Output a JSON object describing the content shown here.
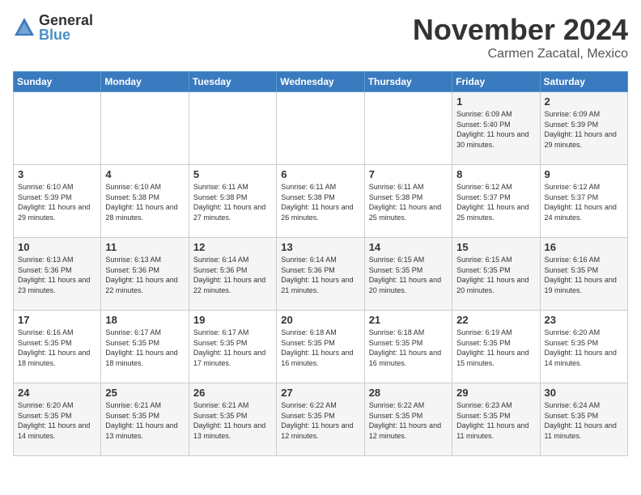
{
  "logo": {
    "text_general": "General",
    "text_blue": "Blue"
  },
  "title": "November 2024",
  "subtitle": "Carmen Zacatal, Mexico",
  "days_of_week": [
    "Sunday",
    "Monday",
    "Tuesday",
    "Wednesday",
    "Thursday",
    "Friday",
    "Saturday"
  ],
  "weeks": [
    [
      {
        "day": "",
        "info": ""
      },
      {
        "day": "",
        "info": ""
      },
      {
        "day": "",
        "info": ""
      },
      {
        "day": "",
        "info": ""
      },
      {
        "day": "",
        "info": ""
      },
      {
        "day": "1",
        "info": "Sunrise: 6:09 AM\nSunset: 5:40 PM\nDaylight: 11 hours and 30 minutes."
      },
      {
        "day": "2",
        "info": "Sunrise: 6:09 AM\nSunset: 5:39 PM\nDaylight: 11 hours and 29 minutes."
      }
    ],
    [
      {
        "day": "3",
        "info": "Sunrise: 6:10 AM\nSunset: 5:39 PM\nDaylight: 11 hours and 29 minutes."
      },
      {
        "day": "4",
        "info": "Sunrise: 6:10 AM\nSunset: 5:38 PM\nDaylight: 11 hours and 28 minutes."
      },
      {
        "day": "5",
        "info": "Sunrise: 6:11 AM\nSunset: 5:38 PM\nDaylight: 11 hours and 27 minutes."
      },
      {
        "day": "6",
        "info": "Sunrise: 6:11 AM\nSunset: 5:38 PM\nDaylight: 11 hours and 26 minutes."
      },
      {
        "day": "7",
        "info": "Sunrise: 6:11 AM\nSunset: 5:38 PM\nDaylight: 11 hours and 25 minutes."
      },
      {
        "day": "8",
        "info": "Sunrise: 6:12 AM\nSunset: 5:37 PM\nDaylight: 11 hours and 25 minutes."
      },
      {
        "day": "9",
        "info": "Sunrise: 6:12 AM\nSunset: 5:37 PM\nDaylight: 11 hours and 24 minutes."
      }
    ],
    [
      {
        "day": "10",
        "info": "Sunrise: 6:13 AM\nSunset: 5:36 PM\nDaylight: 11 hours and 23 minutes."
      },
      {
        "day": "11",
        "info": "Sunrise: 6:13 AM\nSunset: 5:36 PM\nDaylight: 11 hours and 22 minutes."
      },
      {
        "day": "12",
        "info": "Sunrise: 6:14 AM\nSunset: 5:36 PM\nDaylight: 11 hours and 22 minutes."
      },
      {
        "day": "13",
        "info": "Sunrise: 6:14 AM\nSunset: 5:36 PM\nDaylight: 11 hours and 21 minutes."
      },
      {
        "day": "14",
        "info": "Sunrise: 6:15 AM\nSunset: 5:35 PM\nDaylight: 11 hours and 20 minutes."
      },
      {
        "day": "15",
        "info": "Sunrise: 6:15 AM\nSunset: 5:35 PM\nDaylight: 11 hours and 20 minutes."
      },
      {
        "day": "16",
        "info": "Sunrise: 6:16 AM\nSunset: 5:35 PM\nDaylight: 11 hours and 19 minutes."
      }
    ],
    [
      {
        "day": "17",
        "info": "Sunrise: 6:16 AM\nSunset: 5:35 PM\nDaylight: 11 hours and 18 minutes."
      },
      {
        "day": "18",
        "info": "Sunrise: 6:17 AM\nSunset: 5:35 PM\nDaylight: 11 hours and 18 minutes."
      },
      {
        "day": "19",
        "info": "Sunrise: 6:17 AM\nSunset: 5:35 PM\nDaylight: 11 hours and 17 minutes."
      },
      {
        "day": "20",
        "info": "Sunrise: 6:18 AM\nSunset: 5:35 PM\nDaylight: 11 hours and 16 minutes."
      },
      {
        "day": "21",
        "info": "Sunrise: 6:18 AM\nSunset: 5:35 PM\nDaylight: 11 hours and 16 minutes."
      },
      {
        "day": "22",
        "info": "Sunrise: 6:19 AM\nSunset: 5:35 PM\nDaylight: 11 hours and 15 minutes."
      },
      {
        "day": "23",
        "info": "Sunrise: 6:20 AM\nSunset: 5:35 PM\nDaylight: 11 hours and 14 minutes."
      }
    ],
    [
      {
        "day": "24",
        "info": "Sunrise: 6:20 AM\nSunset: 5:35 PM\nDaylight: 11 hours and 14 minutes."
      },
      {
        "day": "25",
        "info": "Sunrise: 6:21 AM\nSunset: 5:35 PM\nDaylight: 11 hours and 13 minutes."
      },
      {
        "day": "26",
        "info": "Sunrise: 6:21 AM\nSunset: 5:35 PM\nDaylight: 11 hours and 13 minutes."
      },
      {
        "day": "27",
        "info": "Sunrise: 6:22 AM\nSunset: 5:35 PM\nDaylight: 11 hours and 12 minutes."
      },
      {
        "day": "28",
        "info": "Sunrise: 6:22 AM\nSunset: 5:35 PM\nDaylight: 11 hours and 12 minutes."
      },
      {
        "day": "29",
        "info": "Sunrise: 6:23 AM\nSunset: 5:35 PM\nDaylight: 11 hours and 11 minutes."
      },
      {
        "day": "30",
        "info": "Sunrise: 6:24 AM\nSunset: 5:35 PM\nDaylight: 11 hours and 11 minutes."
      }
    ]
  ]
}
